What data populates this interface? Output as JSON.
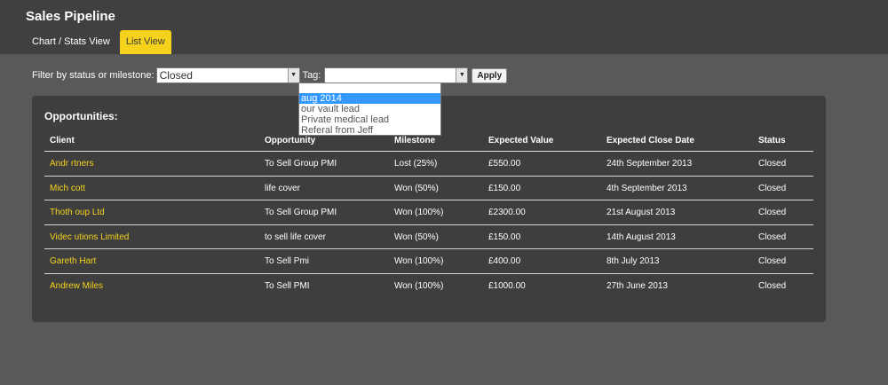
{
  "app": {
    "title": "Sales Pipeline"
  },
  "tabs": [
    {
      "label": "Chart / Stats View",
      "active": false
    },
    {
      "label": "List View",
      "active": true
    }
  ],
  "filter": {
    "label": "Filter by status or milestone:",
    "status_value": "Closed",
    "tag_label": "Tag:",
    "tag_value": "",
    "apply_label": "Apply"
  },
  "tag_dropdown": {
    "options": [
      "",
      "aug 2014",
      "our vault lead",
      "Private medical lead",
      "Referal from Jeff"
    ],
    "highlighted": "aug 2014"
  },
  "opportunities": {
    "title": "Opportunities:",
    "columns": [
      "Client",
      "Opportunity",
      "Milestone",
      "Expected Value",
      "Expected Close Date",
      "Status"
    ],
    "rows": [
      {
        "client": "Andr                rtners",
        "opportunity": "To Sell Group PMI",
        "milestone": "Lost (25%)",
        "value": "£550.00",
        "close_date": "24th September 2013",
        "status": "Closed"
      },
      {
        "client": "Mich        cott",
        "opportunity": "life cover",
        "milestone": "Won (50%)",
        "value": "£150.00",
        "close_date": "4th September 2013",
        "status": "Closed"
      },
      {
        "client": "Thoth         oup Ltd",
        "opportunity": "To Sell Group PMI",
        "milestone": "Won (100%)",
        "value": "£2300.00",
        "close_date": "21st August 2013",
        "status": "Closed"
      },
      {
        "client": "Videc                      utions Limited",
        "opportunity": "to sell life cover",
        "milestone": "Won (50%)",
        "value": "£150.00",
        "close_date": "14th August 2013",
        "status": "Closed"
      },
      {
        "client": "Gareth Hart",
        "opportunity": "To Sell Pmi",
        "milestone": "Won (100%)",
        "value": "£400.00",
        "close_date": "8th July 2013",
        "status": "Closed"
      },
      {
        "client": "Andrew Miles",
        "opportunity": "To Sell PMI",
        "milestone": "Won (100%)",
        "value": "£1000.00",
        "close_date": "27th June 2013",
        "status": "Closed"
      }
    ]
  },
  "colors": {
    "accent": "#f5d31c",
    "header_bg": "#404040",
    "page_bg": "#595959",
    "panel_bg": "#3e3e3e",
    "selection": "#3399ff"
  },
  "icons": {
    "select_arrow": "chevron-down-icon"
  }
}
